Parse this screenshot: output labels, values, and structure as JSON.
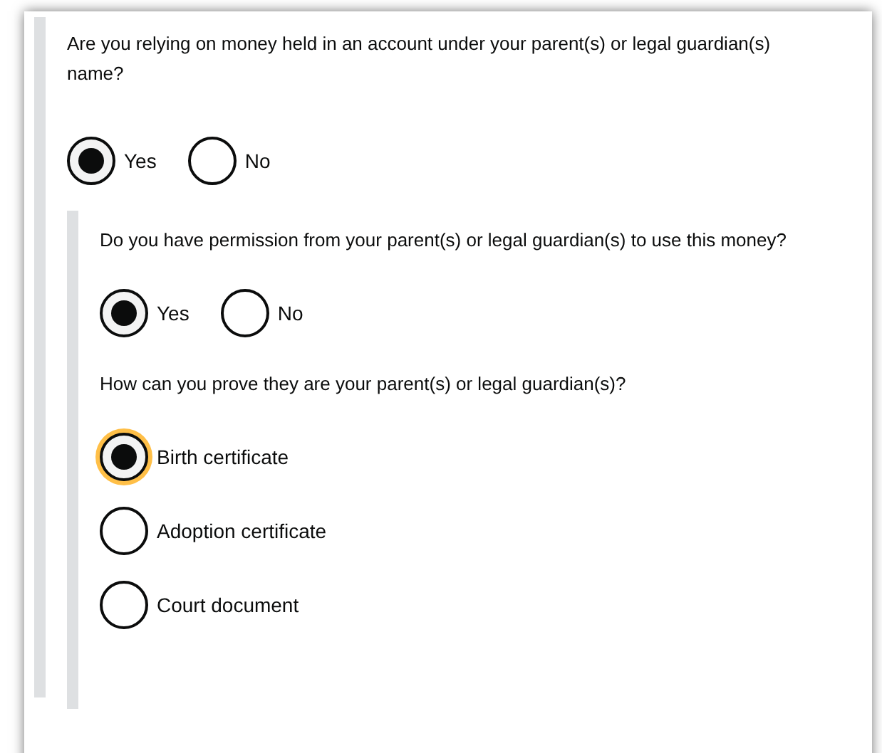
{
  "question": "Are you relying on money held in an account under your parent(s) or legal guardian(s) name?",
  "options": [
    {
      "label": "Yes",
      "selected": true
    },
    {
      "label": "No",
      "selected": false
    }
  ],
  "follow_up": {
    "permission": {
      "question": "Do you have permission from your parent(s) or legal guardian(s) to use this money?",
      "options": [
        {
          "label": "Yes",
          "selected": true
        },
        {
          "label": "No",
          "selected": false
        }
      ]
    },
    "proof": {
      "question": "How can you prove they are your parent(s) or legal guardian(s)?",
      "options": [
        {
          "label": "Birth certificate",
          "selected": true,
          "focused": true
        },
        {
          "label": "Adoption certificate",
          "selected": false,
          "focused": false
        },
        {
          "label": "Court document",
          "selected": false,
          "focused": false
        }
      ]
    }
  }
}
